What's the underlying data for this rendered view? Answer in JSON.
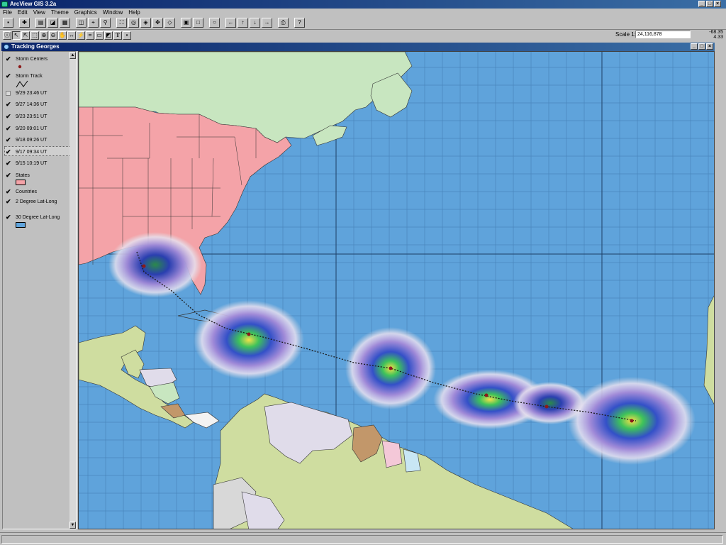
{
  "app": {
    "title": "ArcView GIS 3.2a",
    "window_buttons": [
      "_",
      "□",
      "×"
    ]
  },
  "menu": [
    "File",
    "Edit",
    "View",
    "Theme",
    "Graphics",
    "Window",
    "Help"
  ],
  "scale": {
    "label": "Scale 1:",
    "value": "24,116,878",
    "x_coord": "-68.35",
    "y_coord": "4.33"
  },
  "doc": {
    "title": "Tracking Georges",
    "window_buttons": [
      "_",
      "□",
      "×"
    ]
  },
  "toc": [
    {
      "label": "Storm Centers",
      "checked": true,
      "legend": "dot"
    },
    {
      "label": "Storm Track",
      "checked": true,
      "legend": "line"
    },
    {
      "label": "9/29 23:46 UT",
      "checked": false
    },
    {
      "label": "9/27 14:36 UT",
      "checked": true
    },
    {
      "label": "9/23 23:51 UT",
      "checked": true
    },
    {
      "label": "9/20 09:01 UT",
      "checked": true
    },
    {
      "label": "9/18 09:26 UT",
      "checked": true
    },
    {
      "label": "9/17 09:34 UT",
      "checked": true
    },
    {
      "label": "9/15 10:19 UT",
      "checked": true
    },
    {
      "label": "States",
      "checked": true,
      "legend": "swatch"
    },
    {
      "label": "Countries",
      "checked": true
    },
    {
      "label": "2 Degree Lat-Long",
      "checked": true
    },
    {
      "label": "30 Degree Lat-Long",
      "checked": true,
      "legend": "swatch"
    }
  ],
  "colors": {
    "ocean": "#5fa3db",
    "us_states": "#f4a3a8",
    "canada": "#c8e6c0",
    "south_america": "#cfdda0",
    "storm_track": "#1a1a1a",
    "title_bar": "#0a246a",
    "states_swatch": "#f4a3a8",
    "grid30_swatch": "#5fa3db"
  }
}
